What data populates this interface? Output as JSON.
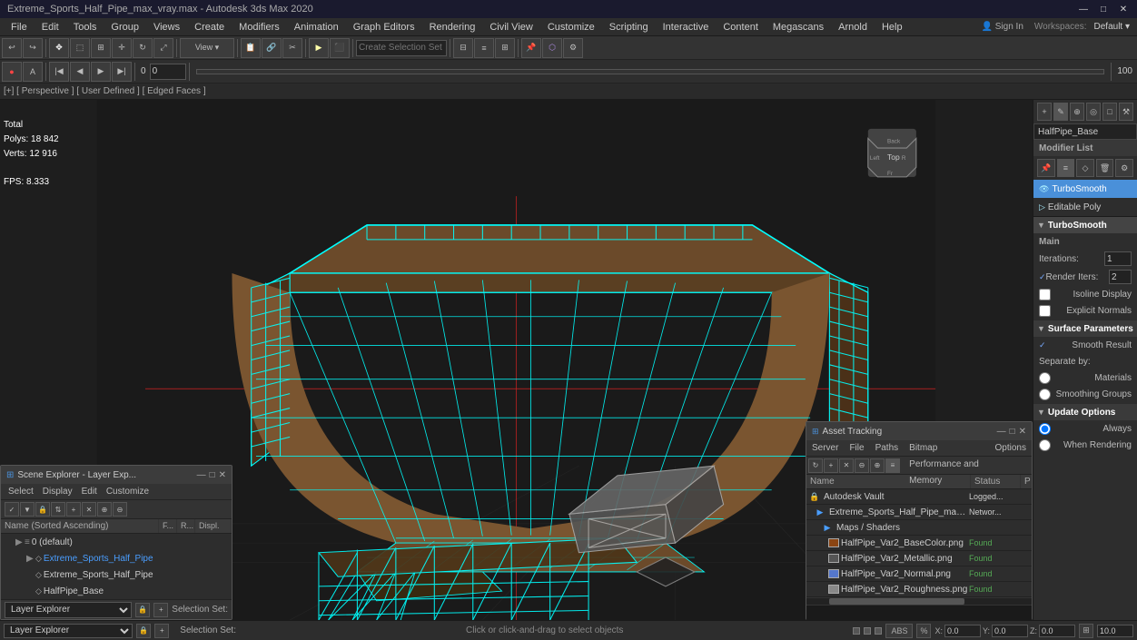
{
  "titleBar": {
    "title": "Extreme_Sports_Half_Pipe_max_vray.max - Autodesk 3ds Max 2020",
    "controls": [
      "—",
      "□",
      "✕"
    ]
  },
  "menuBar": {
    "items": [
      "File",
      "Edit",
      "Tools",
      "Group",
      "Views",
      "Create",
      "Modifiers",
      "Animation",
      "Graph Editors",
      "Rendering",
      "Civil View",
      "Customize",
      "Scripting",
      "Interactive",
      "Content",
      "Megascans",
      "Arnold",
      "Help"
    ]
  },
  "toolbar1": {
    "sign_in": "Sign In",
    "workspaces": "Workspaces:",
    "default": "Default",
    "view_dropdown": "View"
  },
  "toolbar2": {
    "create_selection_set": "Create Selection Set"
  },
  "viewport": {
    "label": "[+] [ Perspective ] [ User Defined ] [ Edged Faces ]",
    "stats": {
      "total_label": "Total",
      "polys_label": "Polys:",
      "polys_value": "18 842",
      "verts_label": "Verts:",
      "verts_value": "12 916"
    },
    "fps_label": "FPS:",
    "fps_value": "8.333"
  },
  "rightPanel": {
    "objectName": "HalfPipe_Base",
    "modifierListLabel": "Modifier List",
    "modifiers": [
      {
        "name": "TurboSmooth",
        "active": true
      },
      {
        "name": "Editable Poly",
        "active": false
      }
    ],
    "turboSmooth": {
      "title": "TurboSmooth",
      "main": "Main",
      "iterations_label": "Iterations:",
      "iterations_value": "1",
      "render_iters_label": "Render Iters:",
      "render_iters_value": "2",
      "isoline_display": "Isoline Display",
      "explicit_normals": "Explicit Normals",
      "surface_params": "Surface Parameters",
      "smooth_result": "Smooth Result",
      "separate_by": "Separate by:",
      "materials": "Materials",
      "smoothing_groups": "Smoothing Groups",
      "update_options": "Update Options",
      "always": "Always",
      "when_rendering": "When Rendering"
    }
  },
  "sceneExplorer": {
    "title": "Scene Explorer - Layer Exp...",
    "menus": [
      "Select",
      "Display",
      "Edit",
      "Customize"
    ],
    "columnHeaders": [
      "Name (Sorted Ascending)",
      "F...",
      "R...",
      "Display"
    ],
    "rows": [
      {
        "name": "0 (default)",
        "indent": 1,
        "hasArrow": true,
        "type": "layer"
      },
      {
        "name": "Extreme_Sports_Half_Pipe",
        "indent": 2,
        "hasArrow": true,
        "type": "object",
        "highlighted": true
      },
      {
        "name": "Extreme_Sports_Half_Pipe",
        "indent": 2,
        "hasArrow": false,
        "type": "object"
      },
      {
        "name": "HalfPipe_Base",
        "indent": 2,
        "hasArrow": false,
        "type": "object"
      }
    ],
    "bottomDropdown": "Layer Explorer",
    "selectionSet": "Selection Set:"
  },
  "assetTracking": {
    "title": "Asset Tracking",
    "menus": [
      "Server",
      "File",
      "Paths",
      "Bitmap Performance and Memory",
      "Options"
    ],
    "columns": [
      "Name",
      "Status",
      "P"
    ],
    "rows": [
      {
        "icon": "🔒",
        "name": "Autodesk Vault",
        "status": "Logged...",
        "indent": 0,
        "type": "server"
      },
      {
        "icon": "📁",
        "name": "Extreme_Sports_Half_Pipe_max_vray.max",
        "status": "Networ...",
        "indent": 1,
        "type": "file"
      },
      {
        "icon": "📁",
        "name": "Maps / Shaders",
        "status": "",
        "indent": 2,
        "type": "folder"
      },
      {
        "icon": "🖼",
        "name": "HalfPipe_Var2_BaseColor.png",
        "status": "Found",
        "indent": 3,
        "type": "map"
      },
      {
        "icon": "🖼",
        "name": "HalfPipe_Var2_Metallic.png",
        "status": "Found",
        "indent": 3,
        "type": "map"
      },
      {
        "icon": "🖼",
        "name": "HalfPipe_Var2_Normal.png",
        "status": "Found",
        "indent": 3,
        "type": "map"
      },
      {
        "icon": "🖼",
        "name": "HalfPipe_Var2_Roughness.png",
        "status": "Found",
        "indent": 3,
        "type": "map"
      }
    ]
  },
  "statusBar": {
    "selectionSet": "Selection Set:",
    "layerExplorer": "Layer Explorer"
  },
  "colors": {
    "background": "#1e1e1e",
    "accent": "#4a90d9",
    "cyan": "#00ffff",
    "panel": "#2d2d2d",
    "active_modifier": "#4a6fa5"
  }
}
